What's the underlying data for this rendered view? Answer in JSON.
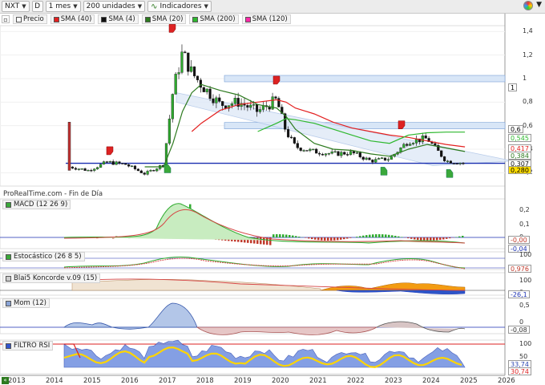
{
  "toolbar": {
    "symbol": "NXT",
    "period": "1 mes",
    "units": "200 unidades",
    "indicators": "Indicadores"
  },
  "legend": [
    {
      "label": "Precio",
      "color": "#ffffff"
    },
    {
      "label": "SMA (40)",
      "color": "#e32020"
    },
    {
      "label": "SMA (4)",
      "color": "#111111"
    },
    {
      "label": "SMA (20)",
      "color": "#2d7a1f"
    },
    {
      "label": "SMA (200)",
      "color": "#2eb82e"
    },
    {
      "label": "SMA (120)",
      "color": "#ff2aa8"
    }
  ],
  "source_note": "ProRealTime.com - Fin de Día",
  "panels": {
    "macd": "MACD (12 26 9)",
    "stoch": "Estocástico (26 8 5)",
    "blai": "Blai5 Koncorde v.09 (15)",
    "mom": "Mom (12)",
    "rsi": "FILTRO RSI"
  },
  "price_axis": [
    "1,4",
    "1,2",
    "1",
    "0,8",
    "0,6",
    "0,4",
    "0,2"
  ],
  "price_badges": [
    {
      "text": "1",
      "color": "#000000",
      "bg": "#ffffff"
    },
    {
      "text": "0,6",
      "color": "#000000",
      "bg": "#ffffff"
    },
    {
      "text": "0,545",
      "color": "#2eb82e",
      "bg": "#ffffff"
    },
    {
      "text": "0,417",
      "color": "#e32020",
      "bg": "#ffffff"
    },
    {
      "text": "0,384",
      "color": "#2d7a1f",
      "bg": "#ffffff"
    },
    {
      "text": "0,307",
      "color": "#111111",
      "bg": "#ffffff"
    },
    {
      "text": "0,280",
      "color": "#000000",
      "bg": "#ffdd00"
    }
  ],
  "macd_axis": [
    "0,2",
    "0,1",
    "0"
  ],
  "macd_badges": [
    "-0,00",
    "-0,04"
  ],
  "stoch_axis": [
    "100",
    "0"
  ],
  "stoch_badges": [
    "0,976"
  ],
  "blai_axis": [
    "100",
    "0"
  ],
  "blai_badges": [
    "-26,1"
  ],
  "mom_axis": [
    "0,5",
    "0"
  ],
  "mom_badges": [
    "-0,08"
  ],
  "rsi_axis": [
    "100",
    "50",
    "0"
  ],
  "rsi_badges": [
    "33,74",
    "30,74"
  ],
  "years": [
    "2013",
    "2014",
    "2015",
    "2016",
    "2017",
    "2018",
    "2019",
    "2020",
    "2021",
    "2022",
    "2023",
    "2024",
    "2025",
    "2026"
  ],
  "colors": {
    "up": "#2eaa2e",
    "down": "#111111",
    "sma40": "#e32020",
    "sma20": "#2d7a1f",
    "sma200": "#2eb82e",
    "signal_up": "#3aa83a",
    "signal_down": "#dd2222"
  },
  "chart_data": {
    "type": "line",
    "title": "NXT",
    "xlabel": "",
    "ylabel": "",
    "ylim": [
      0.1,
      1.45
    ],
    "x": [
      "2014-06",
      "2014-12",
      "2015-06",
      "2015-12",
      "2016-06",
      "2016-12",
      "2017-03",
      "2017-06",
      "2017-09",
      "2017-12",
      "2018-06",
      "2018-12",
      "2019-06",
      "2019-12",
      "2020-03",
      "2020-06",
      "2020-12",
      "2021-06",
      "2021-12",
      "2022-06",
      "2022-12",
      "2023-06",
      "2023-12",
      "2024-06",
      "2024-12"
    ],
    "series": [
      {
        "name": "Precio",
        "values": [
          0.25,
          0.22,
          0.29,
          0.27,
          0.19,
          0.27,
          0.9,
          1.22,
          1.05,
          0.95,
          0.78,
          0.8,
          0.72,
          0.82,
          0.55,
          0.42,
          0.38,
          0.36,
          0.37,
          0.3,
          0.32,
          0.47,
          0.49,
          0.3,
          0.28
        ]
      },
      {
        "name": "SMA (40)",
        "values": [
          null,
          null,
          null,
          null,
          null,
          null,
          null,
          null,
          0.55,
          0.62,
          0.73,
          0.78,
          0.8,
          0.82,
          0.8,
          0.75,
          0.7,
          0.63,
          0.58,
          0.55,
          0.52,
          0.5,
          0.47,
          0.44,
          0.42
        ]
      },
      {
        "name": "SMA (20)",
        "values": [
          null,
          null,
          null,
          null,
          0.25,
          0.25,
          0.45,
          0.72,
          0.88,
          0.95,
          0.9,
          0.86,
          0.78,
          0.75,
          0.68,
          0.57,
          0.45,
          0.4,
          0.39,
          0.36,
          0.34,
          0.4,
          0.44,
          0.41,
          0.38
        ]
      },
      {
        "name": "SMA (200)",
        "values": [
          null,
          null,
          null,
          null,
          null,
          null,
          null,
          null,
          null,
          null,
          null,
          null,
          0.55,
          0.62,
          0.66,
          0.65,
          0.62,
          0.57,
          0.52,
          0.47,
          0.45,
          0.52,
          0.54,
          0.545,
          0.545
        ]
      }
    ],
    "support": 0.28,
    "resistance": [
      1.0,
      0.6
    ]
  }
}
